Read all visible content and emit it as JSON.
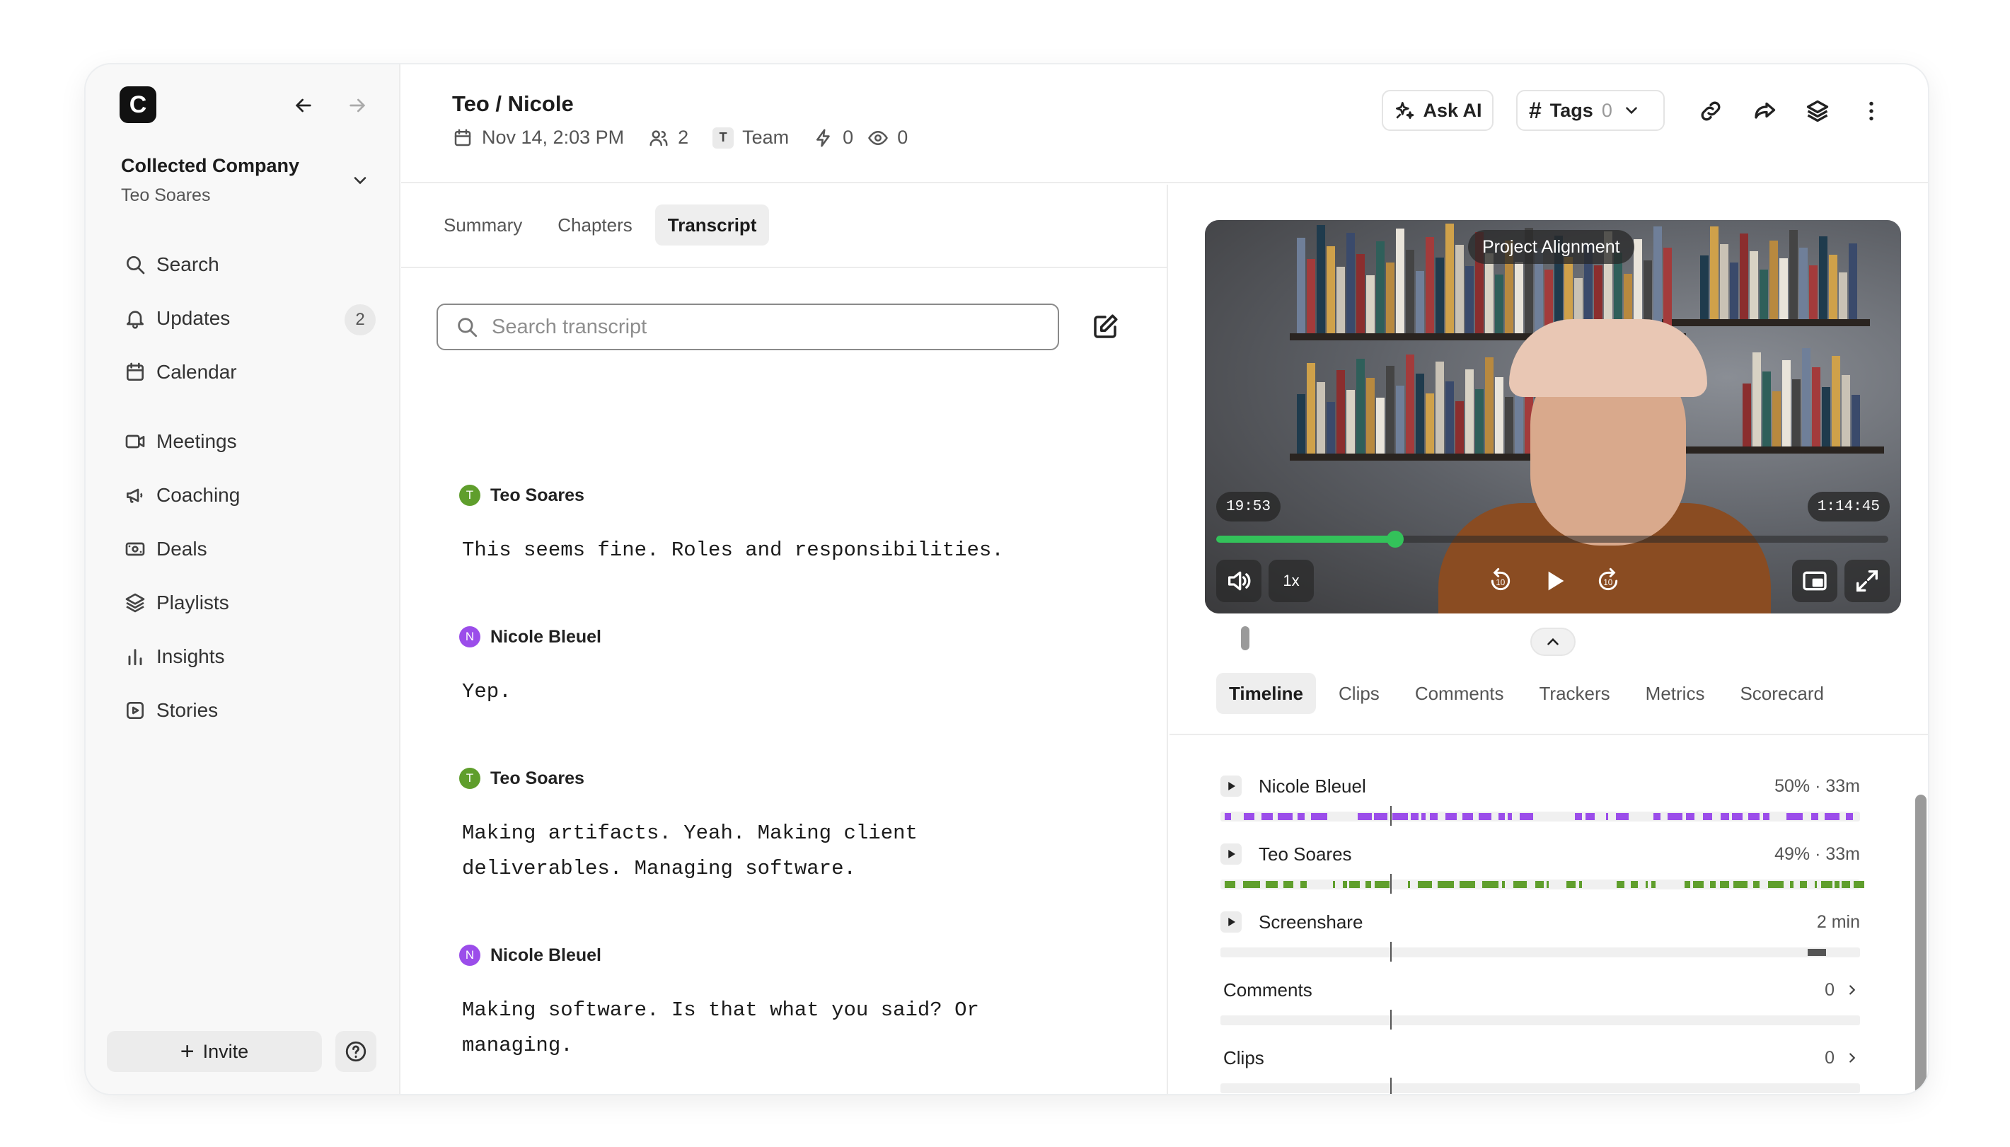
{
  "sidebar": {
    "logo_letter": "C",
    "org_name": "Collected Company",
    "org_user": "Teo Soares",
    "items": [
      {
        "label": "Search",
        "icon": "search-icon"
      },
      {
        "label": "Updates",
        "icon": "bell-icon",
        "badge": "2"
      },
      {
        "label": "Calendar",
        "icon": "calendar-icon"
      },
      {
        "label": "Meetings",
        "icon": "video-camera-icon"
      },
      {
        "label": "Coaching",
        "icon": "megaphone-icon"
      },
      {
        "label": "Deals",
        "icon": "dollar-icon"
      },
      {
        "label": "Playlists",
        "icon": "layers-icon"
      },
      {
        "label": "Insights",
        "icon": "bar-chart-icon"
      },
      {
        "label": "Stories",
        "icon": "play-square-icon"
      }
    ],
    "invite_label": "Invite"
  },
  "header": {
    "title": "Teo / Nicole",
    "date": "Nov 14, 2:03 PM",
    "participants": "2",
    "team_chip": "T",
    "team": "Team",
    "actions_count": "0",
    "views_count": "0",
    "ask_ai_label": "Ask AI",
    "tags_label": "Tags",
    "tags_count": "0"
  },
  "transcript": {
    "tabs": [
      "Summary",
      "Chapters",
      "Transcript"
    ],
    "active_tab": "Transcript",
    "search_placeholder": "Search transcript",
    "entries": [
      {
        "speaker": "Teo Soares",
        "initial": "T",
        "text": "This seems fine. Roles and responsibilities."
      },
      {
        "speaker": "Nicole Bleuel",
        "initial": "N",
        "text": "Yep."
      },
      {
        "speaker": "Teo Soares",
        "initial": "T",
        "text": "Making artifacts. Yeah. Making client deliverables. Managing software."
      },
      {
        "speaker": "Nicole Bleuel",
        "initial": "N",
        "text": "Making software. Is that what you said? Or managing."
      }
    ]
  },
  "video": {
    "title": "Project Alignment",
    "current_time": "19:53",
    "duration": "1:14:45",
    "speed": "1x",
    "progress_fraction": 0.266
  },
  "panel": {
    "tabs": [
      "Timeline",
      "Clips",
      "Comments",
      "Trackers",
      "Metrics",
      "Scorecard"
    ],
    "active_tab": "Timeline",
    "rows": [
      {
        "label": "Nicole Bleuel",
        "stat": "50% · 33m",
        "color": "#9b4dea"
      },
      {
        "label": "Teo Soares",
        "stat": "49% · 33m",
        "color": "#5f9e2c"
      },
      {
        "label": "Screenshare",
        "stat": "2 min",
        "color": "#555555"
      },
      {
        "label": "Comments",
        "stat": "0"
      },
      {
        "label": "Clips",
        "stat": "0"
      }
    ]
  },
  "colors": {
    "accent_green": "#33c25a",
    "nicole_purple": "#9b4dea",
    "teo_green": "#5f9e2c"
  }
}
